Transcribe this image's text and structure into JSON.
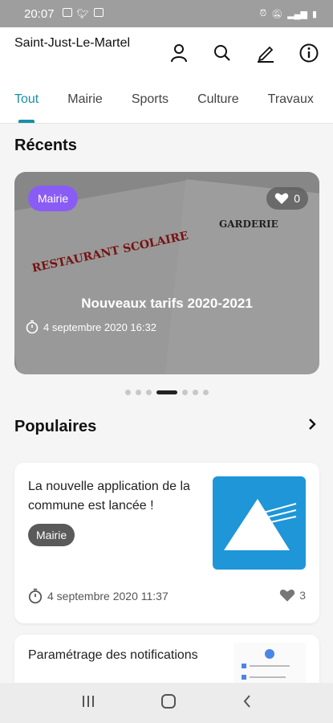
{
  "status_bar": {
    "time": "20:07",
    "left_icons": [
      "image-icon",
      "twitter-icon",
      "check-icon"
    ],
    "right_icons": [
      "alarm-icon",
      "mute-icon",
      "signal-icon",
      "battery-icon"
    ]
  },
  "app": {
    "title": "Saint-Just-Le-Martel"
  },
  "header_actions": [
    {
      "name": "profile-icon"
    },
    {
      "name": "search-icon"
    },
    {
      "name": "edit-icon"
    },
    {
      "name": "info-icon"
    }
  ],
  "tabs": [
    {
      "label": "Tout",
      "active": true
    },
    {
      "label": "Mairie"
    },
    {
      "label": "Sports"
    },
    {
      "label": "Culture"
    },
    {
      "label": "Travaux"
    }
  ],
  "recents": {
    "title": "Récents",
    "card": {
      "category": "Mairie",
      "likes": "0",
      "headline": "Nouveaux tarifs 2020-2021",
      "date": "4 septembre 2020 16:32",
      "image_text_1": "RESTAURANT SCOLAIRE",
      "image_text_2": "GARDERIE"
    },
    "pager": {
      "count": 7,
      "active_index": 3
    }
  },
  "populaires": {
    "title": "Populaires",
    "items": [
      {
        "title": "La nouvelle application de la commune est lancée !",
        "category": "Mairie",
        "date": "4 septembre 2020 11:37",
        "likes": "3"
      },
      {
        "title": "Paramétrage des notifications"
      }
    ]
  },
  "colors": {
    "accent": "#1a8fa6",
    "badge": "#8a5cf6",
    "thumb_blue": "#1e96d8"
  }
}
